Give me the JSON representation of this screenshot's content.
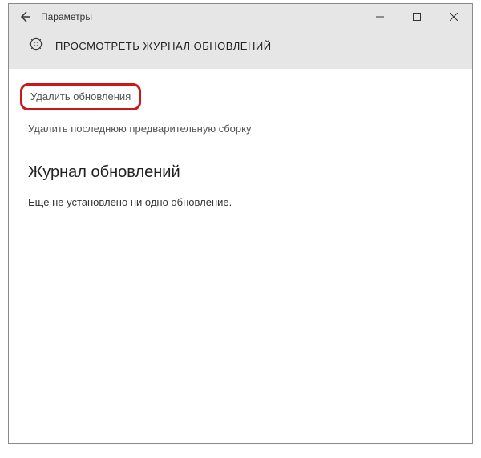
{
  "titlebar": {
    "app_title": "Параметры"
  },
  "header": {
    "page_title": "ПРОСМОТРЕТЬ ЖУРНАЛ ОБНОВЛЕНИЙ"
  },
  "content": {
    "uninstall_link": "Удалить обновления",
    "remove_preview_link": "Удалить последнюю предварительную сборку",
    "history_heading": "Журнал обновлений",
    "no_updates_text": "Еще не установлено ни одно обновление."
  }
}
